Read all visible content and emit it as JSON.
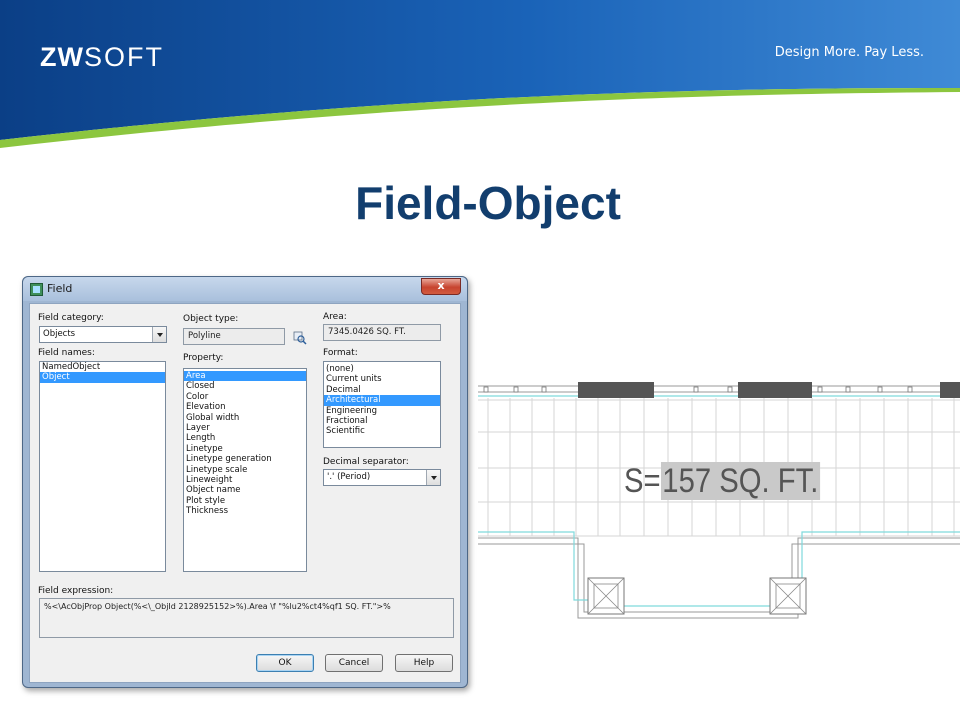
{
  "slide": {
    "logo_main": "ZW",
    "logo_suffix": "SOFT",
    "tagline": "Design More. Pay Less.",
    "title": "Field-Object",
    "colors": {
      "banner_blue": "#0a4f9a",
      "banner_green": "#8cc63f",
      "title_blue": "#123e6e"
    }
  },
  "dialog": {
    "title": "Field",
    "close_label": "x",
    "field_category": {
      "label": "Field category:",
      "value": "Objects"
    },
    "field_names": {
      "label": "Field names:",
      "items": [
        {
          "text": "NamedObject",
          "selected": false
        },
        {
          "text": "Object",
          "selected": true
        }
      ]
    },
    "object_type": {
      "label": "Object type:",
      "value": "Polyline",
      "pick_icon": "select-object-icon"
    },
    "property": {
      "label": "Property:",
      "items": [
        {
          "text": "Area",
          "selected": true
        },
        {
          "text": "Closed",
          "selected": false
        },
        {
          "text": "Color",
          "selected": false
        },
        {
          "text": "Elevation",
          "selected": false
        },
        {
          "text": "Global width",
          "selected": false
        },
        {
          "text": "Layer",
          "selected": false
        },
        {
          "text": "Length",
          "selected": false
        },
        {
          "text": "Linetype",
          "selected": false
        },
        {
          "text": "Linetype generation",
          "selected": false
        },
        {
          "text": "Linetype scale",
          "selected": false
        },
        {
          "text": "Lineweight",
          "selected": false
        },
        {
          "text": "Object name",
          "selected": false
        },
        {
          "text": "Plot style",
          "selected": false
        },
        {
          "text": "Thickness",
          "selected": false
        }
      ]
    },
    "area": {
      "label": "Area:",
      "value": "7345.0426 SQ. FT."
    },
    "format": {
      "label": "Format:",
      "items": [
        {
          "text": "(none)",
          "selected": false
        },
        {
          "text": "Current units",
          "selected": false
        },
        {
          "text": "Decimal",
          "selected": false
        },
        {
          "text": "Architectural",
          "selected": true
        },
        {
          "text": "Engineering",
          "selected": false
        },
        {
          "text": "Fractional",
          "selected": false
        },
        {
          "text": "Scientific",
          "selected": false
        }
      ]
    },
    "decimal_separator": {
      "label": "Decimal separator:",
      "value": "'.' (Period)"
    },
    "field_expression": {
      "label": "Field expression:",
      "value": "%<\\AcObjProp Object(%<\\_ObjId 2128925152>%).Area \\f \"%lu2%ct4%qf1 SQ. FT.\">%"
    },
    "buttons": {
      "ok": "OK",
      "cancel": "Cancel",
      "help": "Help"
    }
  },
  "cad": {
    "field_prefix": "S=",
    "field_value": "157 SQ. FT."
  }
}
